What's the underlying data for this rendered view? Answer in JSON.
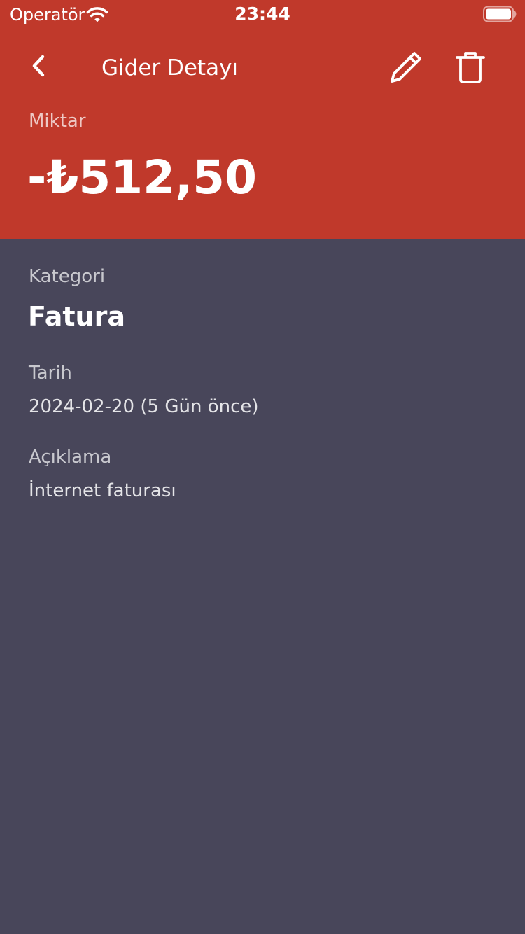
{
  "status_bar": {
    "carrier": "Operatör",
    "time": "23:44",
    "wifi_icon": "wifi-icon",
    "battery_icon": "battery-icon"
  },
  "nav": {
    "title": "Gider Detayı",
    "back_icon": "chevron-left-icon",
    "edit_icon": "pencil-icon",
    "delete_icon": "trash-icon"
  },
  "amount": {
    "label": "Miktar",
    "value": "-₺512,50"
  },
  "category": {
    "label": "Kategori",
    "value": "Fatura"
  },
  "date": {
    "label": "Tarih",
    "value": "2024-02-20 (5 Gün önce)"
  },
  "description": {
    "label": "Açıklama",
    "value": "İnternet faturası"
  },
  "colors": {
    "header_background": "#c0392b",
    "body_background": "#48465a",
    "text_primary": "#ffffff"
  }
}
